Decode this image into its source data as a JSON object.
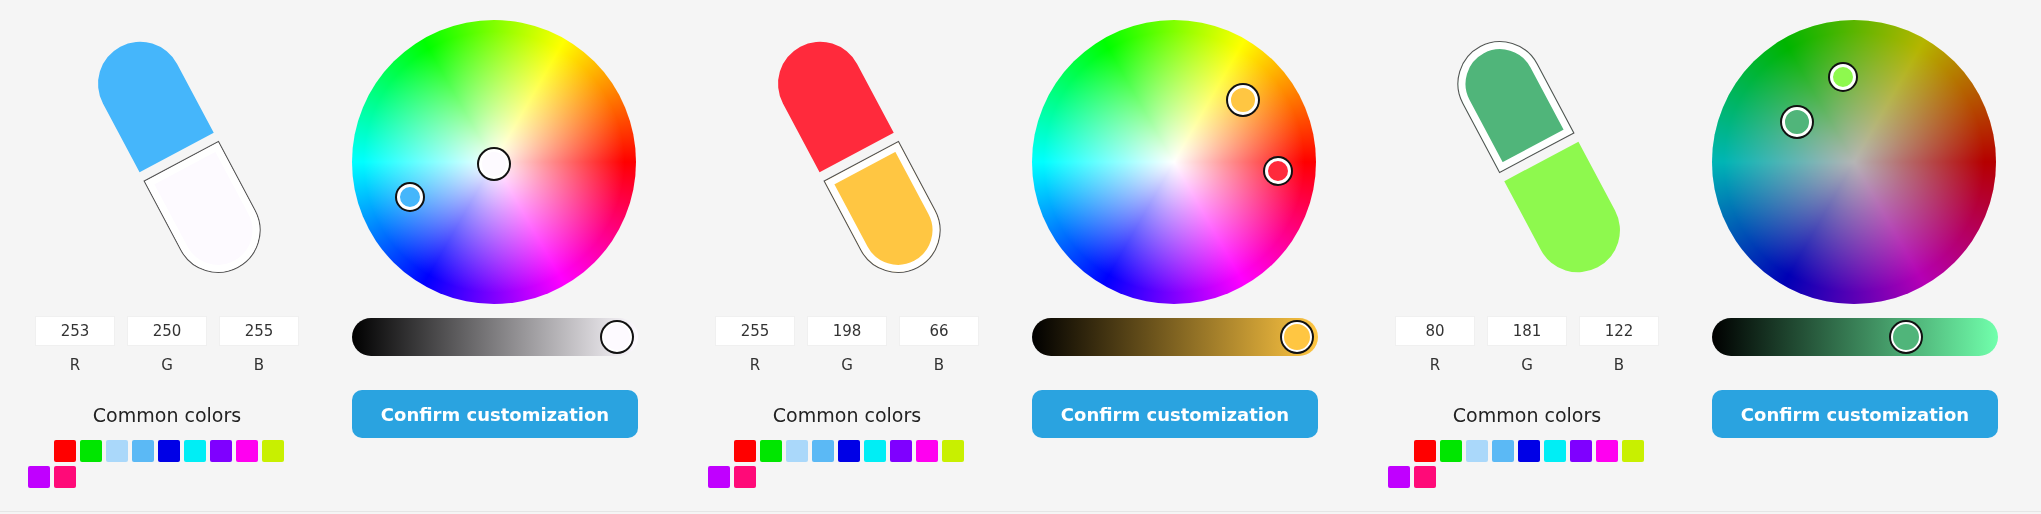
{
  "pickers": [
    {
      "capsule": {
        "halves": [
          {
            "color": "#45b6fb",
            "selected": false
          },
          {
            "color": "#fdfaff",
            "selected": true
          }
        ]
      },
      "rgb": [
        {
          "value": "253",
          "label": "R"
        },
        {
          "value": "250",
          "label": "G"
        },
        {
          "value": "255",
          "label": "B"
        }
      ],
      "brightness": {
        "level": 1
      },
      "common_colors": {
        "title": "Common colors",
        "swatches": [
          {
            "color": "#ff0000"
          },
          {
            "color": "#00e600"
          },
          {
            "color": "#aad8fa"
          },
          {
            "color": "#5bb9f5"
          },
          {
            "color": "#0000e6"
          },
          {
            "color": "#00eef5"
          },
          {
            "color": "#7f00ff"
          },
          {
            "color": "#ff00f0"
          },
          {
            "color": "#c8f000"
          },
          {
            "color": "#c000ff"
          },
          {
            "color": "#ff0a78"
          }
        ]
      },
      "button": "Confirm customization"
    },
    {
      "capsule": {
        "halves": [
          {
            "color": "#ff2a3c",
            "selected": false
          },
          {
            "color": "#ffc642",
            "selected": true
          }
        ]
      },
      "rgb": [
        {
          "value": "255",
          "label": "R"
        },
        {
          "value": "198",
          "label": "G"
        },
        {
          "value": "66",
          "label": "B"
        }
      ],
      "brightness": {
        "level": 1
      },
      "common_colors": {
        "title": "Common colors",
        "swatches": [
          {
            "color": "#ff0000"
          },
          {
            "color": "#00e600"
          },
          {
            "color": "#aad8fa"
          },
          {
            "color": "#5bb9f5"
          },
          {
            "color": "#0000e6"
          },
          {
            "color": "#00eef5"
          },
          {
            "color": "#7f00ff"
          },
          {
            "color": "#ff00f0"
          },
          {
            "color": "#c8f000"
          },
          {
            "color": "#c000ff"
          },
          {
            "color": "#ff0a78"
          }
        ]
      },
      "button": "Confirm customization"
    },
    {
      "capsule": {
        "halves": [
          {
            "color": "#50b57a",
            "selected": true
          },
          {
            "color": "#8ef94e",
            "selected": false
          }
        ]
      },
      "rgb": [
        {
          "value": "80",
          "label": "R"
        },
        {
          "value": "181",
          "label": "G"
        },
        {
          "value": "122",
          "label": "B"
        }
      ],
      "brightness": {
        "level": 0.71
      },
      "common_colors": {
        "title": "Common colors",
        "swatches": [
          {
            "color": "#ff0000"
          },
          {
            "color": "#00e600"
          },
          {
            "color": "#aad8fa"
          },
          {
            "color": "#5bb9f5"
          },
          {
            "color": "#0000e6"
          },
          {
            "color": "#00eef5"
          },
          {
            "color": "#7f00ff"
          },
          {
            "color": "#ff00f0"
          },
          {
            "color": "#c8f000"
          },
          {
            "color": "#c000ff"
          },
          {
            "color": "#ff0a78"
          }
        ]
      },
      "button": "Confirm customization"
    }
  ]
}
